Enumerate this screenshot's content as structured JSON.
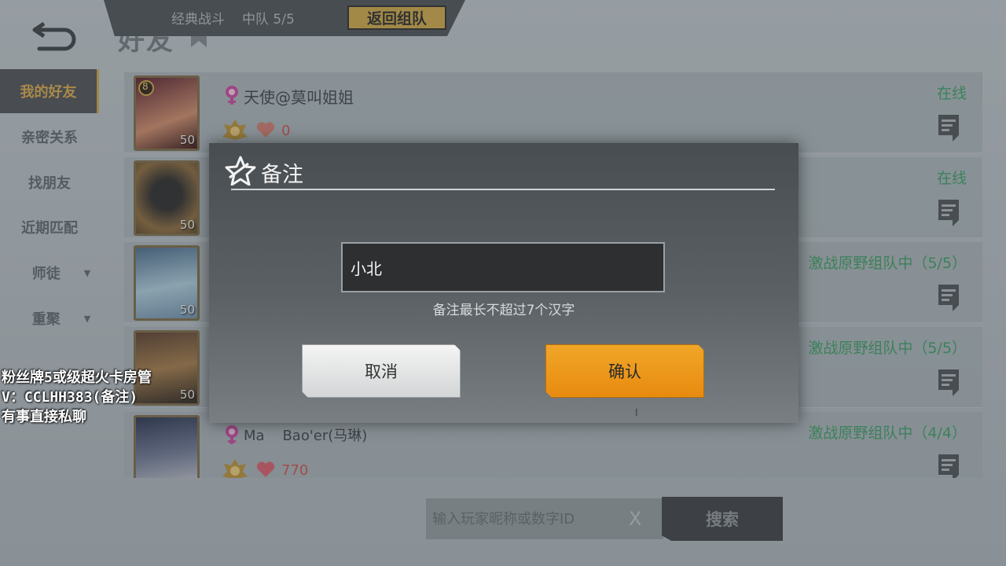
{
  "header": {
    "title": "好友",
    "mode": "经典战斗",
    "squad": "中队 5/5",
    "return_button": "返回组队"
  },
  "sidebar": {
    "items": [
      {
        "label": "我的好友",
        "active": true
      },
      {
        "label": "亲密关系"
      },
      {
        "label": "找朋友"
      },
      {
        "label": "近期匹配"
      },
      {
        "label": "师徒",
        "arrow": "▼"
      },
      {
        "label": "重聚",
        "arrow": "▼"
      }
    ]
  },
  "friends": [
    {
      "name": "天使@莫叫姐姐",
      "level": "50",
      "badge": "8",
      "intimacy": "0",
      "status": "在线"
    },
    {
      "name": "",
      "level": "50",
      "status": "在线"
    },
    {
      "name": "",
      "level": "50",
      "status": "激战原野组队中（5/5）"
    },
    {
      "name": "",
      "level": "50",
      "status": "激战原野组队中（5/5）"
    },
    {
      "name": "Ma    Bao'er(马琳)",
      "level": "",
      "intimacy": "770",
      "status": "激战原野组队中（4/4）"
    }
  ],
  "search": {
    "placeholder": "输入玩家昵称或数字ID",
    "clear": "X",
    "button": "搜索"
  },
  "modal": {
    "title": "备注",
    "input_value": "小北",
    "hint": "备注最长不超过7个汉字",
    "cancel": "取消",
    "confirm": "确认",
    "cursor": "I"
  },
  "watermark": {
    "line1": "粉丝牌5或级超火卡房管",
    "line2": "V：CCLHH383(备注)",
    "line3": "有事直接私聊"
  },
  "colors": {
    "accent": "#e88b10",
    "online": "#3c9a63",
    "active_tab": "#d3a64c"
  }
}
